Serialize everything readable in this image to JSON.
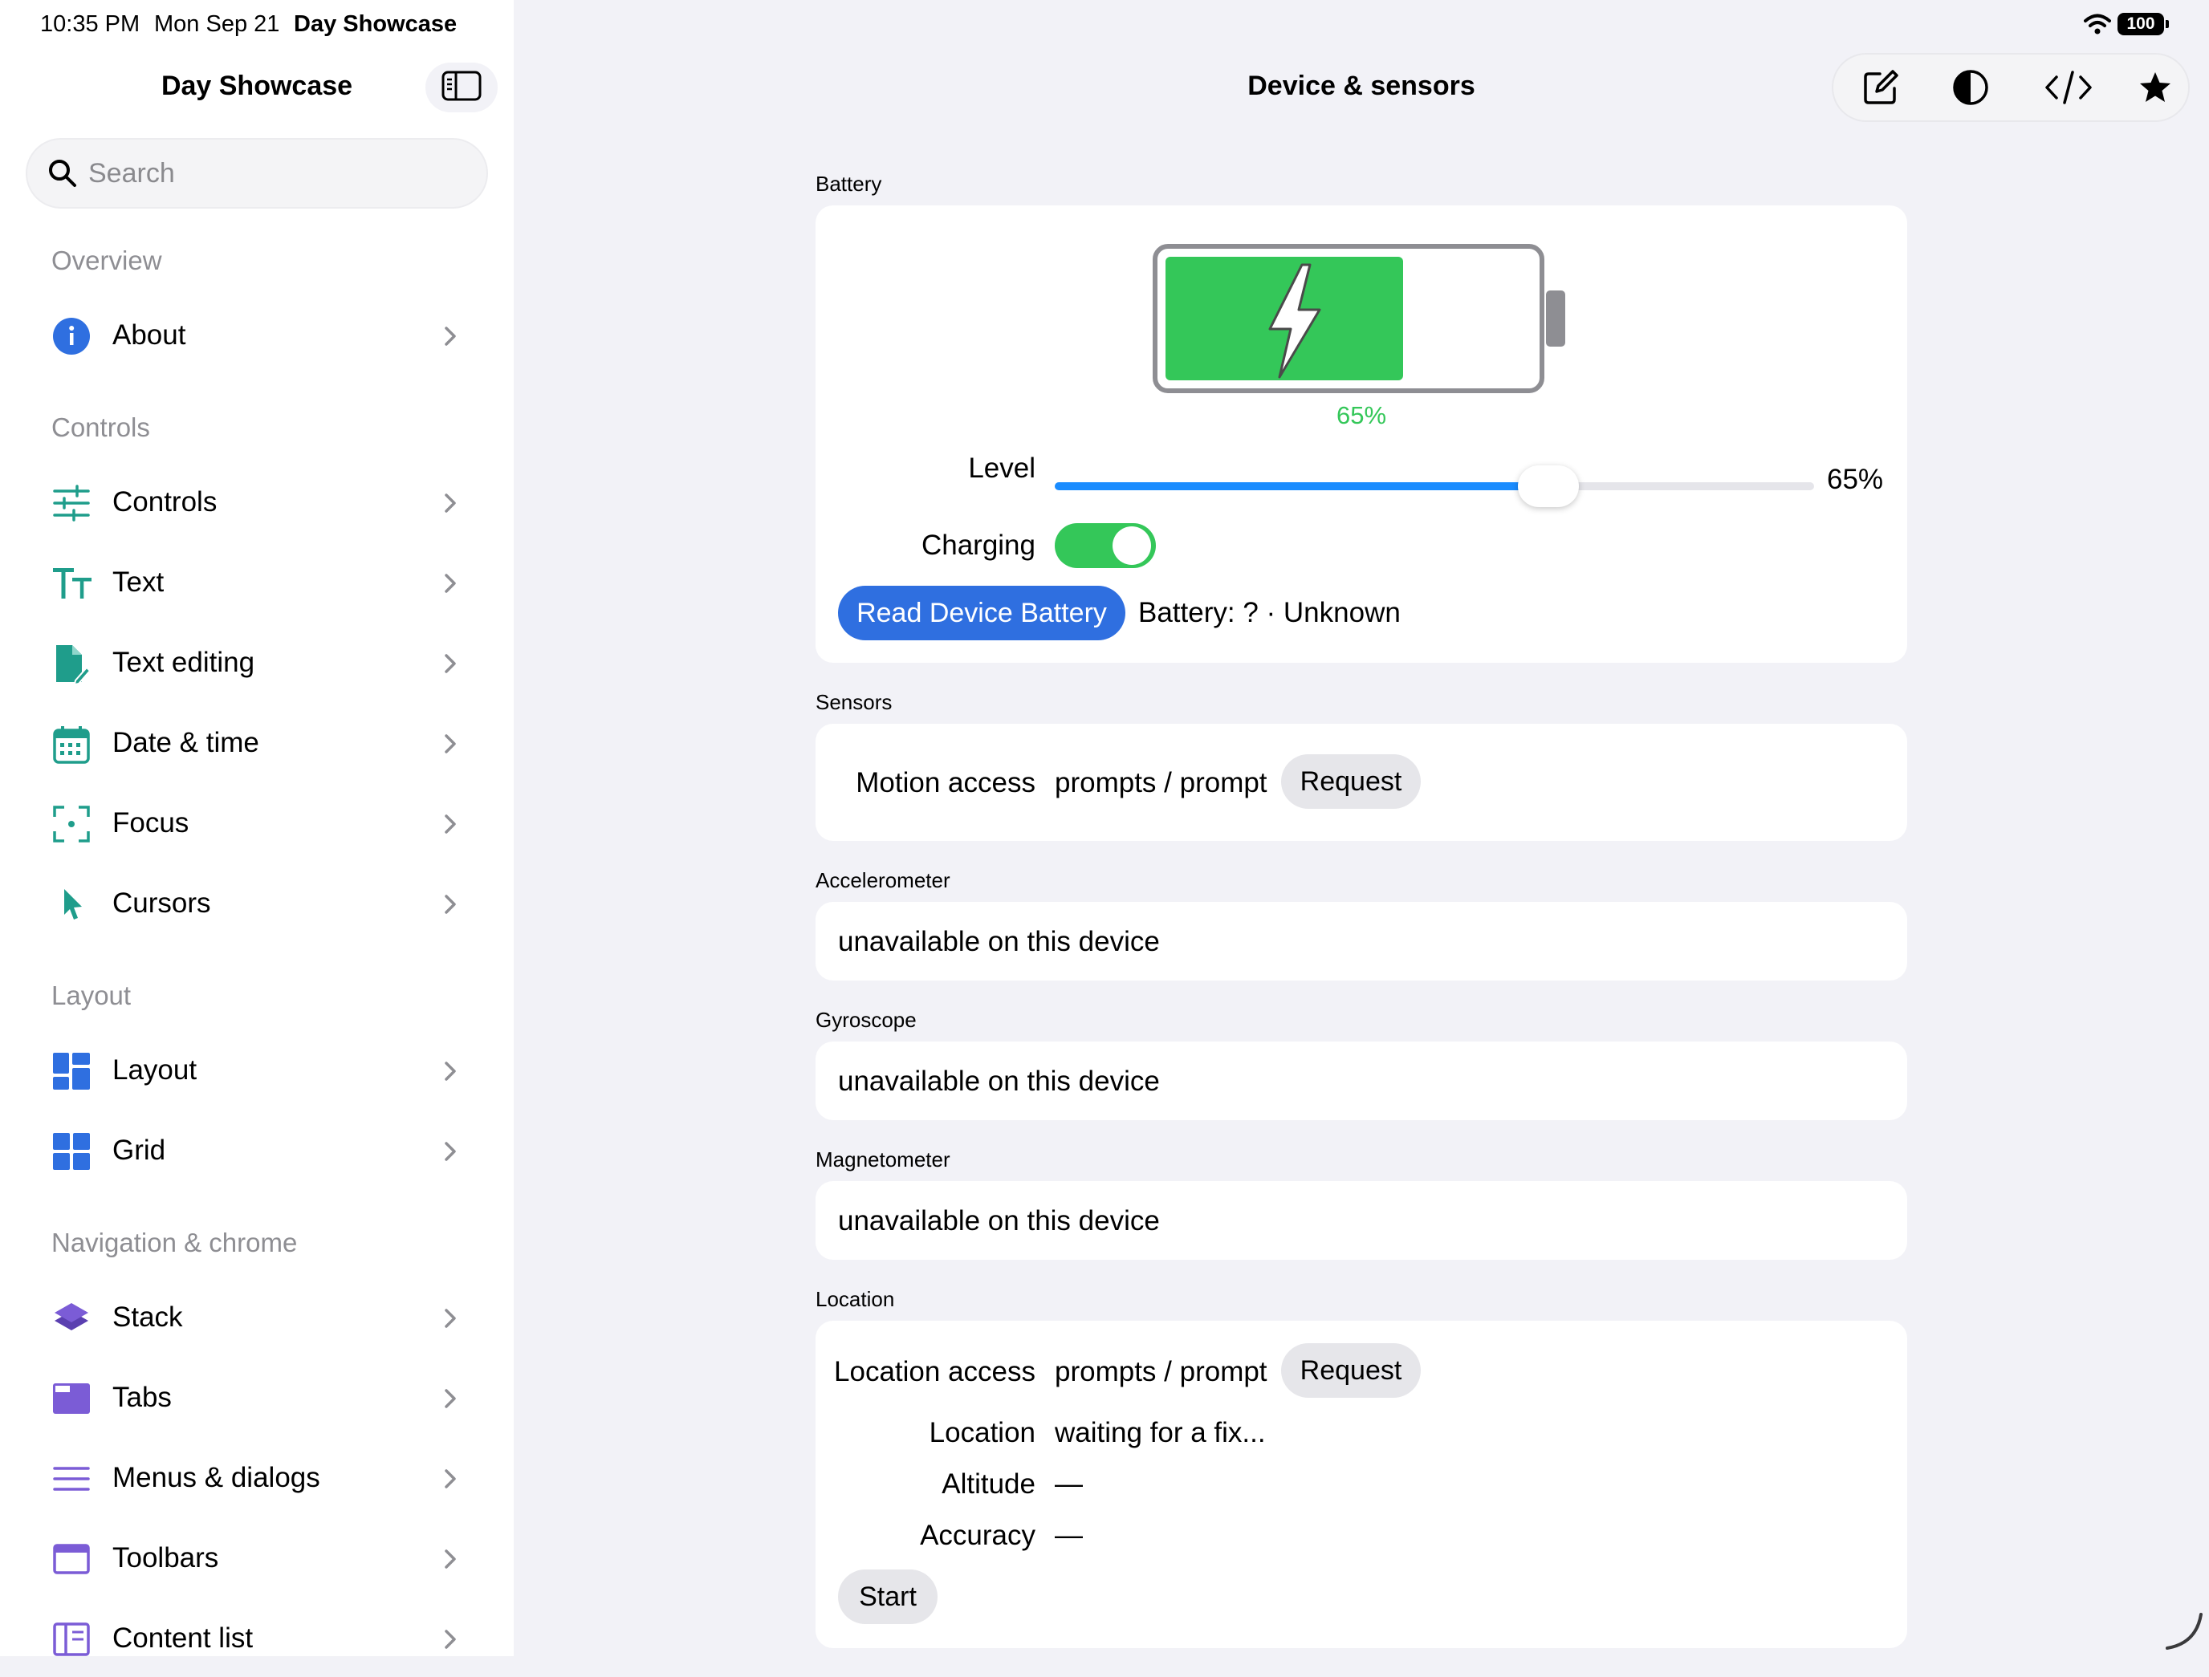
{
  "status_bar": {
    "time": "10:35 PM",
    "date": "Mon Sep 21",
    "app_name": "Day Showcase",
    "battery": "100"
  },
  "sidebar": {
    "title": "Day Showcase",
    "search": {
      "placeholder": "Search",
      "value": ""
    },
    "sections": [
      {
        "header": "Overview",
        "items": [
          {
            "label": "About",
            "icon": "info-circle-icon"
          }
        ]
      },
      {
        "header": "Controls",
        "items": [
          {
            "label": "Controls",
            "icon": "sliders-icon"
          },
          {
            "label": "Text",
            "icon": "text-size-icon"
          },
          {
            "label": "Text editing",
            "icon": "doc-edit-icon"
          },
          {
            "label": "Date & time",
            "icon": "calendar-icon"
          },
          {
            "label": "Focus",
            "icon": "focus-viewfinder-icon"
          },
          {
            "label": "Cursors",
            "icon": "cursor-arrow-icon"
          }
        ]
      },
      {
        "header": "Layout",
        "items": [
          {
            "label": "Layout",
            "icon": "layout-grid-icon"
          },
          {
            "label": "Grid",
            "icon": "grid-icon"
          }
        ]
      },
      {
        "header": "Navigation & chrome",
        "items": [
          {
            "label": "Stack",
            "icon": "stack-layers-icon"
          },
          {
            "label": "Tabs",
            "icon": "tabs-icon"
          },
          {
            "label": "Menus & dialogs",
            "icon": "menu-lines-icon"
          },
          {
            "label": "Toolbars",
            "icon": "toolbar-window-icon"
          },
          {
            "label": "Content list",
            "icon": "content-list-icon"
          }
        ]
      }
    ]
  },
  "main": {
    "title": "Device & sensors",
    "toolbar_icons": [
      "compose-icon",
      "contrast-icon",
      "code-icon",
      "star-icon"
    ],
    "battery": {
      "header": "Battery",
      "percent_label": "65%",
      "level": 0.65,
      "level_label": "Level",
      "level_value": "65%",
      "charging_label": "Charging",
      "charging": true,
      "read_button": "Read Device Battery",
      "status": "Battery: ? · Unknown"
    },
    "sensors": {
      "header": "Sensors",
      "motion_label": "Motion access",
      "motion_value": "prompts / prompt",
      "request_button": "Request"
    },
    "accelerometer": {
      "header": "Accelerometer",
      "value": "unavailable on this device"
    },
    "gyroscope": {
      "header": "Gyroscope",
      "value": "unavailable on this device"
    },
    "magnetometer": {
      "header": "Magnetometer",
      "value": "unavailable on this device"
    },
    "location": {
      "header": "Location",
      "access_label": "Location access",
      "access_value": "prompts / prompt",
      "request_button": "Request",
      "location_label": "Location",
      "location_value": "waiting for a fix...",
      "altitude_label": "Altitude",
      "altitude_value": "—",
      "accuracy_label": "Accuracy",
      "accuracy_value": "—",
      "start_button": "Start"
    }
  },
  "colors": {
    "accent_blue": "#2f6fe0",
    "slider_blue": "#1a8cff",
    "green": "#34c759",
    "teal_icon": "#1f9d8b",
    "purple_icon": "#7b5cd6"
  }
}
